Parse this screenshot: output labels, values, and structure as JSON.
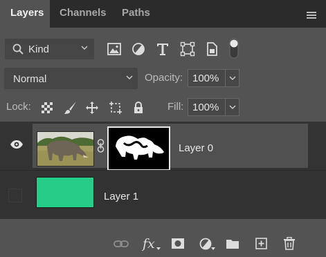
{
  "tabs": [
    {
      "label": "Layers",
      "active": true
    },
    {
      "label": "Channels",
      "active": false
    },
    {
      "label": "Paths",
      "active": false
    }
  ],
  "filter": {
    "kind_label": "Kind",
    "icons": [
      "image-filter-icon",
      "adjustment-filter-icon",
      "type-filter-icon",
      "shape-filter-icon",
      "smart-object-filter-icon",
      "filter-toggle-icon"
    ]
  },
  "blend": {
    "mode": "Normal",
    "opacity_label": "Opacity:",
    "opacity_value": "100%"
  },
  "lock": {
    "label": "Lock:",
    "icons": [
      "lock-transparent-pixels-icon",
      "lock-image-pixels-icon",
      "lock-position-icon",
      "lock-artboard-icon",
      "lock-all-icon"
    ],
    "fill_label": "Fill:",
    "fill_value": "100%"
  },
  "layers": [
    {
      "name": "Layer 0",
      "visible": true,
      "selected": true,
      "has_mask": true
    },
    {
      "name": "Layer 1",
      "visible": false,
      "selected": false,
      "fill_color": "#26cd88"
    }
  ],
  "bottom_icons": [
    "link-layers-icon",
    "fx-icon",
    "add-mask-icon",
    "adjustment-layer-icon",
    "new-group-icon",
    "new-layer-icon",
    "delete-layer-icon"
  ],
  "bottom_fx_label": "fx",
  "colors": {
    "panel_bg": "#535353",
    "tabbar_bg": "#2b2b2b",
    "layer_fill": "#26cd88"
  }
}
